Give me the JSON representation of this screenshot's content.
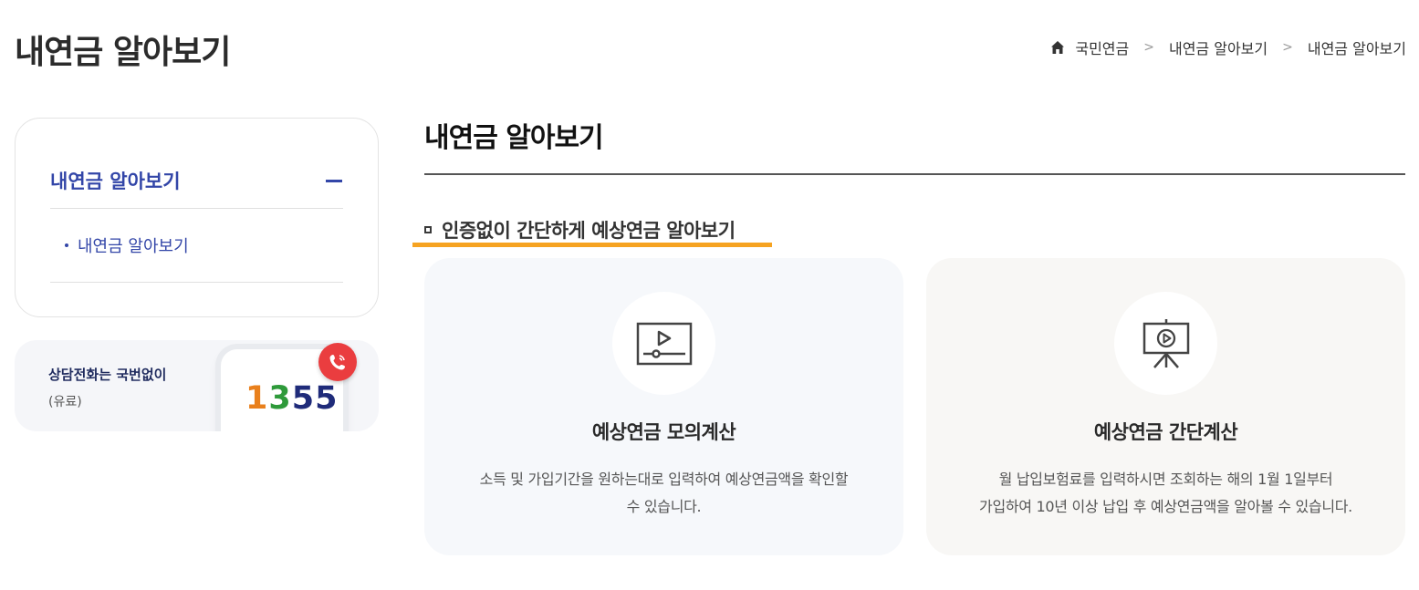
{
  "page": {
    "title": "내연금 알아보기"
  },
  "breadcrumb": {
    "home_icon": "home-icon",
    "items": [
      "국민연금",
      "내연금 알아보기",
      "내연금 알아보기"
    ]
  },
  "sidebar": {
    "menu_title": "내연금 알아보기",
    "collapse_icon": "minus-icon",
    "items": [
      {
        "label": "내연금 알아보기"
      }
    ],
    "call_banner": {
      "title": "상담전화는 국번없이",
      "subtitle": "(유료)",
      "number_parts": [
        "1",
        "3",
        "55"
      ],
      "phone_icon": "phone-icon"
    }
  },
  "main": {
    "title": "내연금 알아보기",
    "section_title": "인증없이 간단하게 예상연금 알아보기",
    "cards": [
      {
        "title": "예상연금 모의계산",
        "desc_line1": "소득 및 가입기간을 원하는대로 입력하여 예상연금액을 확인할",
        "desc_line2": "수 있습니다.",
        "icon": "video-player-icon"
      },
      {
        "title": "예상연금 간단계산",
        "desc_line1": "월 납입보험료를 입력하시면 조회하는 해의 1월 1일부터",
        "desc_line2": "가입하여 10년 이상 납입 후 예상연금액을 알아볼 수 있습니다.",
        "icon": "presentation-board-icon"
      }
    ]
  },
  "colors": {
    "accent_blue": "#3346a8",
    "underline_orange": "#f6a321",
    "call_badge_red": "#ea3d3f"
  }
}
